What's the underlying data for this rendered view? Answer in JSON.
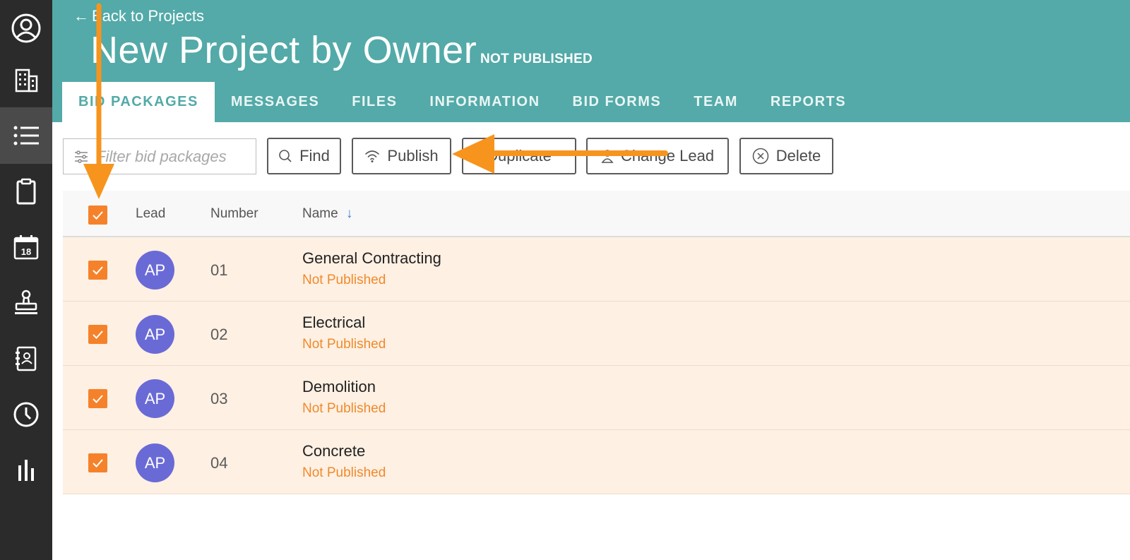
{
  "header": {
    "back_label": "Back to Projects",
    "back_arrow": "←",
    "title": "New Project by Owner",
    "status": "NOT PUBLISHED"
  },
  "tabs": [
    {
      "label": "BID PACKAGES",
      "active": true
    },
    {
      "label": "MESSAGES"
    },
    {
      "label": "FILES"
    },
    {
      "label": "INFORMATION"
    },
    {
      "label": "BID FORMS"
    },
    {
      "label": "TEAM"
    },
    {
      "label": "REPORTS"
    }
  ],
  "toolbar": {
    "filter_placeholder": "Filter bid packages",
    "find_label": "Find",
    "publish_label": "Publish",
    "duplicate_label": "Duplicate",
    "change_lead_label": "Change Lead",
    "delete_label": "Delete"
  },
  "table": {
    "columns": {
      "lead": "Lead",
      "number": "Number",
      "name": "Name",
      "sort_arrow": "↓"
    },
    "rows": [
      {
        "lead": "AP",
        "number": "01",
        "name": "General Contracting",
        "status": "Not Published",
        "checked": true
      },
      {
        "lead": "AP",
        "number": "02",
        "name": "Electrical",
        "status": "Not Published",
        "checked": true
      },
      {
        "lead": "AP",
        "number": "03",
        "name": "Demolition",
        "status": "Not Published",
        "checked": true
      },
      {
        "lead": "AP",
        "number": "04",
        "name": "Concrete",
        "status": "Not Published",
        "checked": true
      }
    ]
  },
  "sidebar": {
    "items": [
      "profile-icon",
      "building-icon",
      "list-icon",
      "clipboard-icon",
      "calendar-icon",
      "stamp-icon",
      "contacts-book-icon",
      "clock-icon",
      "bar-chart-icon"
    ],
    "active_item": "list-icon",
    "calendar_day": "18"
  },
  "colors": {
    "header": "#53aaa8",
    "sidebar": "#2b2b2b",
    "accent_orange": "#f5822a",
    "row_selected": "#fef0e3",
    "avatar": "#6a6ad6",
    "status_text": "#ef8a2c",
    "annotation_arrow": "#f7941d"
  }
}
